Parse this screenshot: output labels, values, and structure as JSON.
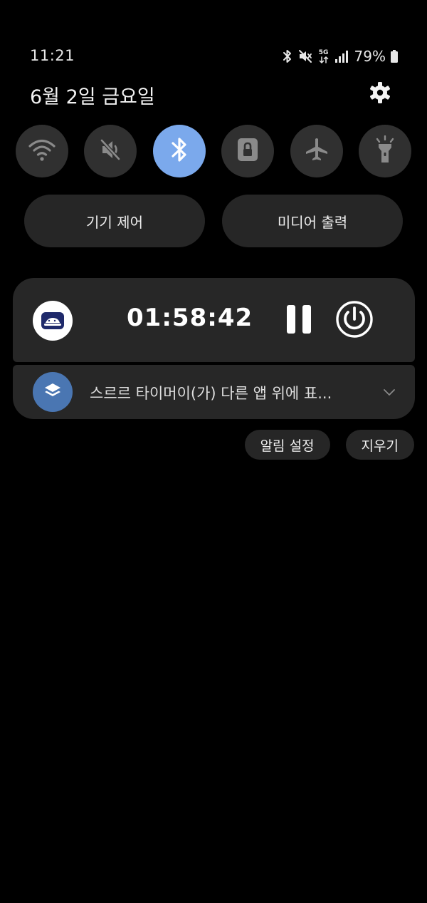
{
  "status_bar": {
    "time": "11:21",
    "network_label": "5G",
    "battery_percent": "79%",
    "icons": [
      "bluetooth-icon",
      "mute-icon",
      "network-5g-icon",
      "signal-icon",
      "battery-icon"
    ]
  },
  "header": {
    "date": "6월 2일 금요일",
    "settings_icon": "gear-icon"
  },
  "quick_toggles": [
    {
      "icon": "wifi-icon",
      "active": false
    },
    {
      "icon": "sound-mute-icon",
      "active": false
    },
    {
      "icon": "bluetooth-icon",
      "active": true
    },
    {
      "icon": "screen-lock-icon",
      "active": false
    },
    {
      "icon": "airplane-icon",
      "active": false
    },
    {
      "icon": "flashlight-icon",
      "active": false
    }
  ],
  "panels": {
    "device_control": "기기 제어",
    "media_output": "미디어 출력"
  },
  "timer_notification": {
    "app_icon": "timer-app-icon",
    "time": "01:58:42",
    "pause_icon": "pause-icon",
    "power_icon": "power-icon"
  },
  "overlay_notification": {
    "app_icon": "layers-icon",
    "text": "스르르 타이머이(가) 다른 앱 위에 표...",
    "expand_icon": "chevron-down-icon"
  },
  "actions": {
    "notification_settings": "알림 설정",
    "clear": "지우기"
  },
  "colors": {
    "background": "#000000",
    "toggle_bg": "#303030",
    "toggle_active": "#7ba9ec",
    "card_bg": "#272727",
    "overlay_icon_bg": "#4a76b2"
  }
}
